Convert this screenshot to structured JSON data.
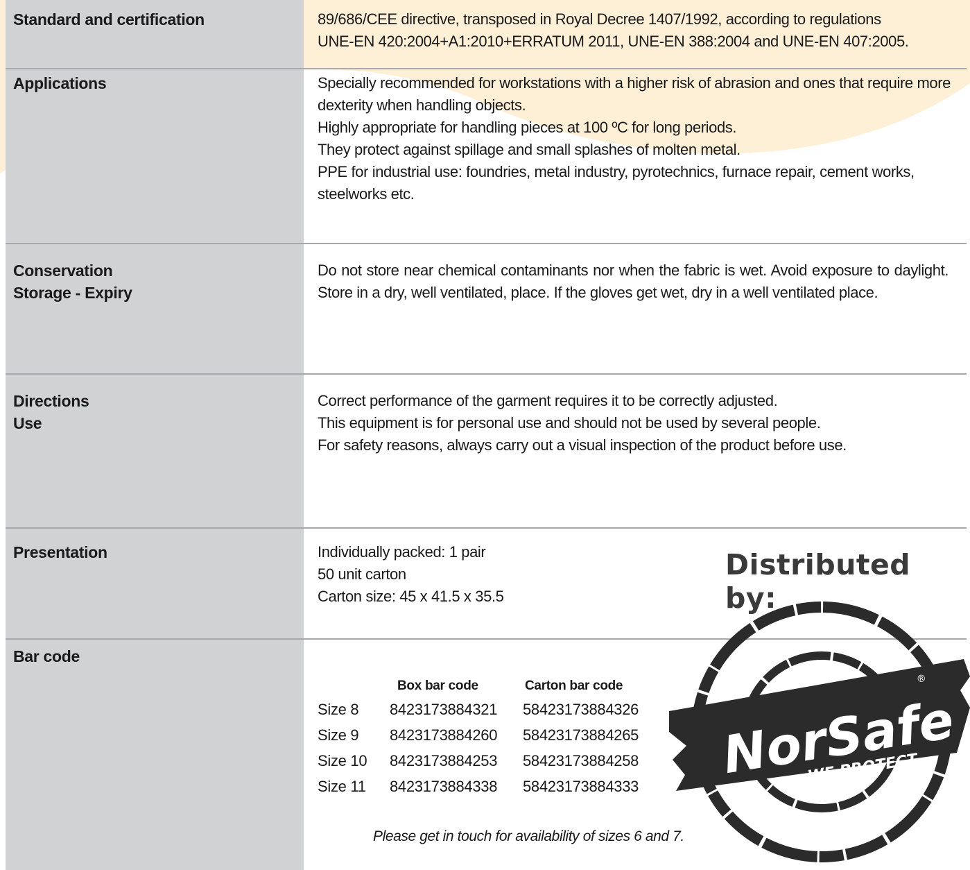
{
  "rows": {
    "standard": {
      "label": "Standard and certification",
      "lines": [
        "89/686/CEE directive, transposed in Royal Decree 1407/1992, according to regulations",
        "UNE-EN 420:2004+A1:2010+ERRATUM 2011, UNE-EN 388:2004 and UNE-EN 407:2005."
      ]
    },
    "applications": {
      "label": "Applications",
      "lines": [
        "Specially recommended for workstations with a higher risk of abrasion and ones that require more dexterity when handling objects.",
        "Highly appropriate for handling pieces at 100 ºC for long periods.",
        "They protect against spillage and small splashes of molten metal.",
        "PPE for industrial use: foundries, metal industry, pyrotechnics, furnace repair, cement works, steelworks etc."
      ]
    },
    "conservation": {
      "label_lines": [
        "Conservation",
        "Storage - Expiry"
      ],
      "text": "Do not store near chemical contaminants nor when the fabric is wet. Avoid exposure to daylight. Store in a dry, well ventilated, place. If the gloves get wet, dry in a well ventilated place."
    },
    "directions": {
      "label_lines": [
        "Directions",
        "Use"
      ],
      "lines": [
        "Correct performance of the garment requires it to be correctly adjusted.",
        "This equipment is for personal use and should not be used by several people.",
        "For safety reasons, always carry out a visual inspection of the product before use."
      ]
    },
    "presentation": {
      "label": "Presentation",
      "lines": [
        "Individually packed: 1 pair",
        "50 unit carton",
        "Carton size: 45 x 41.5 x 35.5"
      ]
    },
    "barcode": {
      "label": "Bar code",
      "headers": {
        "box": "Box bar code",
        "carton": "Carton bar code"
      },
      "rows": [
        {
          "size": "Size 8",
          "box": "8423173884321",
          "carton": "58423173884326"
        },
        {
          "size": "Size 9",
          "box": "8423173884260",
          "carton": "58423173884265"
        },
        {
          "size": "Size 10",
          "box": "8423173884253",
          "carton": "58423173884258"
        },
        {
          "size": "Size 11",
          "box": "8423173884338",
          "carton": "58423173884333"
        }
      ],
      "note": "Please get in touch for availability of sizes 6 and 7."
    }
  },
  "distributor": {
    "heading": "Distributed by:",
    "logo_text": "NorSafe",
    "logo_tagline": "WE PROTECT",
    "logo_mark": "®"
  },
  "colors": {
    "label_bg": "#d1d2d4",
    "divider": "#a7a8ab",
    "wave": "#fde9c9",
    "stamp": "#2b2b2b"
  }
}
